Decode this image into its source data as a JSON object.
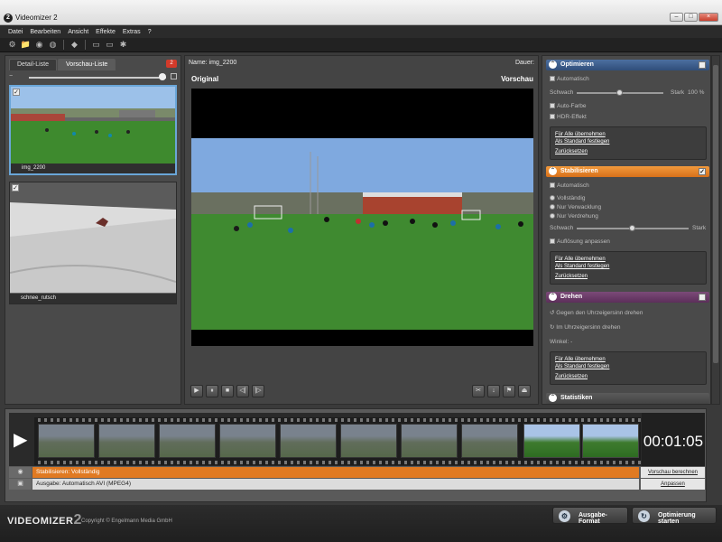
{
  "window": {
    "title": "Videomizer 2",
    "icon_text": "2",
    "btn_min": "–",
    "btn_max": "□",
    "btn_close": "×"
  },
  "menu": [
    "Datei",
    "Bearbeiten",
    "Ansicht",
    "Effekte",
    "Extras",
    "?"
  ],
  "left": {
    "tabs": [
      "Detail-Liste",
      "Vorschau-Liste"
    ],
    "active_tab": 1,
    "badge": "2",
    "zoom_minus": "−",
    "thumbs": [
      {
        "caption": "img_2200",
        "checked": "✓"
      },
      {
        "caption": "schnee_rutsch",
        "checked": "✓"
      }
    ]
  },
  "center": {
    "name_label": "Name: img_2200",
    "duration_label": "Dauer:",
    "original_label": "Original",
    "preview_label": "Vorschau",
    "controls": [
      "▶",
      "⏸",
      "■",
      "◁|",
      "|▷"
    ],
    "controls_right": [
      "✂",
      "↓",
      "⚑",
      "⏏"
    ]
  },
  "right": {
    "optimize": {
      "title": "Optimieren",
      "checked": "",
      "auto": "Automatisch",
      "weak": "Schwach",
      "strong": "Stark",
      "percent": "100 %",
      "level": 0.5,
      "autocolor": "Auto-Farbe",
      "hdr": "HDR-Effekt",
      "link_all": "Für Alle übernehmen",
      "link_default": "Als Standard festlegen",
      "link_reset": "Zurücksetzen"
    },
    "stabilize": {
      "title": "Stabilisieren",
      "checked": "✓",
      "auto": "Automatisch",
      "opt_full": "Vollständig",
      "opt_shake": "Nur Verwacklung",
      "opt_rotate": "Nur Verdrehung",
      "weak": "Schwach",
      "strong": "Stark",
      "level": 0.5,
      "resolution": "Auflösung anpassen",
      "link_all": "Für Alle übernehmen",
      "link_default": "Als Standard festlegen",
      "link_reset": "Zurücksetzen"
    },
    "rotate": {
      "title": "Drehen",
      "checked": "",
      "ccw": "Gegen den Uhrzeigersinn drehen",
      "cw": "Im Uhrzeigersinn drehen",
      "angle": "Winkel: -",
      "link_all": "Für Alle übernehmen",
      "link_default": "Als Standard festlegen",
      "link_reset": "Zurücksetzen"
    },
    "stats": {
      "title": "Statistiken"
    }
  },
  "timeline": {
    "time": "00:01:05",
    "stabilize_row": "Stabilisieren: Vollständig",
    "preview_link": "Vorschau berechnen",
    "output_row": "Ausgabe: Automatisch AVI (MPEG4)",
    "adjust_link": "Anpassen"
  },
  "footer": {
    "logo": "VIDEOMIZER",
    "logo_num": "2",
    "copyright": "Copyright © Engelmann Media GmbH",
    "btn_format": "Ausgabe-Format",
    "btn_start": "Optimierung starten"
  },
  "colors": {
    "accent_blue": "#304e7a",
    "accent_orange": "#d8701a",
    "accent_purple": "#5c2e5a"
  }
}
